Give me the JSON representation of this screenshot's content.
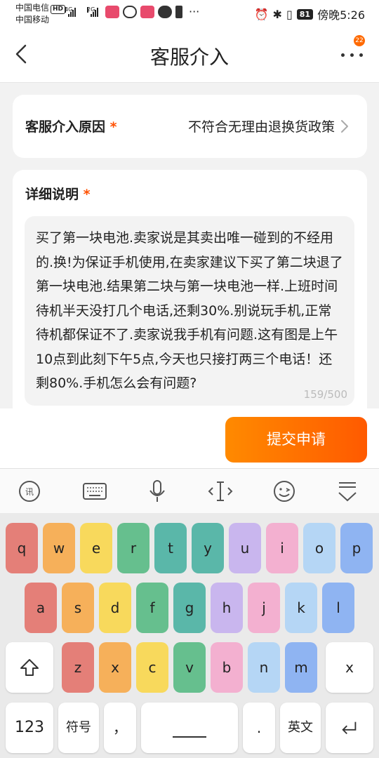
{
  "status_bar": {
    "carrier1": "中国电信",
    "carrier1_badge": "HD",
    "carrier2": "中国移动",
    "network1": "4G",
    "network2": "2G",
    "battery": "81",
    "time": "傍晚5:26"
  },
  "header": {
    "title": "客服介入",
    "badge_count": "22"
  },
  "reason": {
    "label": "客服介入原因",
    "required_mark": "*",
    "value": "不符合无理由退换货政策"
  },
  "details": {
    "label": "详细说明",
    "required_mark": "*",
    "text": "买了第一块电池.卖家说是其卖出唯一碰到的不经用的.换!为保证手机使用,在卖家建议下买了第二块退了第一块电池.结果第二块与第一块电池一样.上班时间待机半天没打几个电话,还剩30%.别说玩手机,正常待机都保证不了.卖家说我手机有问题.这有图是上午10点到此刻下午5点,今天也只接打两三个电话！还剩80%.手机怎么会有问题?",
    "counter": "159/500"
  },
  "submit_label": "提交申请",
  "ime_toolbar": [
    "ifly-logo-icon",
    "keyboard-icon",
    "microphone-icon",
    "cursor-icon",
    "emoji-icon",
    "hide-keyboard-icon"
  ],
  "keyboard": {
    "row1": [
      "q",
      "w",
      "e",
      "r",
      "t",
      "y",
      "u",
      "i",
      "o",
      "p"
    ],
    "row2": [
      "a",
      "s",
      "d",
      "f",
      "g",
      "h",
      "j",
      "k",
      "l"
    ],
    "row3": [
      "z",
      "x",
      "c",
      "v",
      "b",
      "n",
      "m"
    ],
    "delete_label": "x",
    "numbers_label": "123",
    "symbols_label": "符号",
    "comma_label": "，",
    "period_label": ".",
    "lang_label": "英文",
    "colors": {
      "red": "#e47f78",
      "orange": "#f6b05a",
      "yellow": "#f8d95c",
      "green": "#66bf8e",
      "teal": "#5ab7a9",
      "purple": "#c9b6ee",
      "pink": "#f3b0d0",
      "lightblue": "#b5d6f5",
      "blue": "#8fb4f2"
    }
  }
}
